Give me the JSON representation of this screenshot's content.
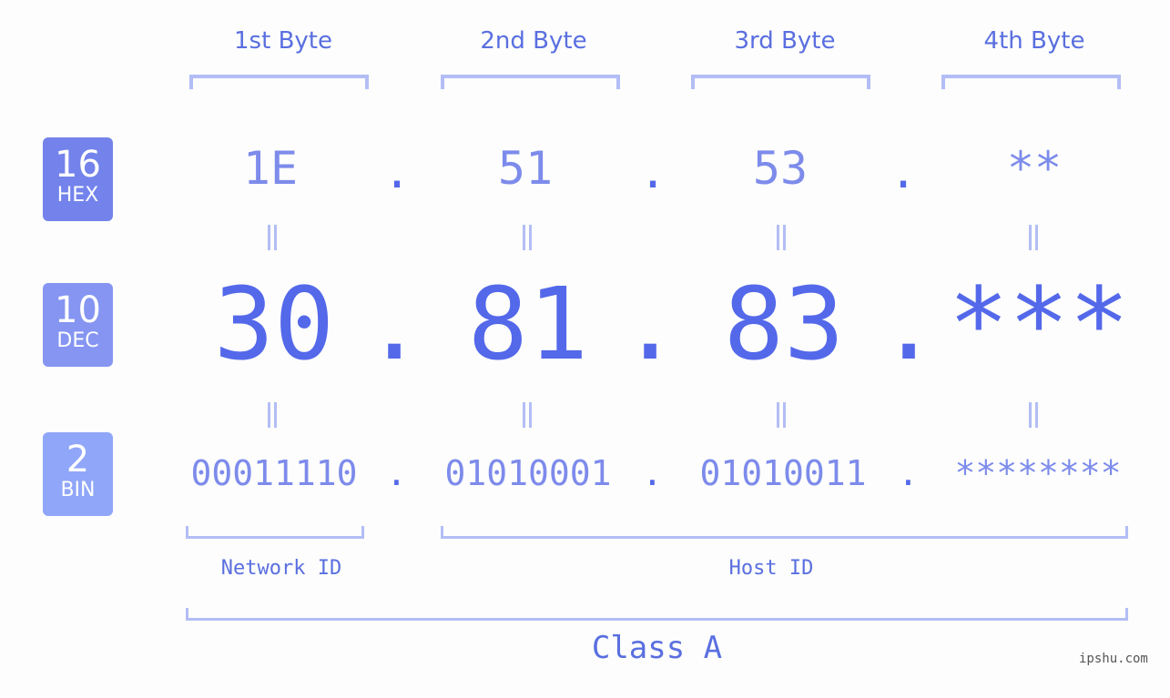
{
  "byte_headers": [
    "1st Byte",
    "2nd Byte",
    "3rd Byte",
    "4th Byte"
  ],
  "badges": [
    {
      "number": "16",
      "label": "HEX",
      "color": "#7383eb"
    },
    {
      "number": "10",
      "label": "DEC",
      "color": "#8595f1"
    },
    {
      "number": "2",
      "label": "BIN",
      "color": "#90a6f8"
    }
  ],
  "hex": [
    "1E",
    "51",
    "53",
    "**"
  ],
  "dec": [
    "30",
    "81",
    "83",
    "***"
  ],
  "bin": [
    "00011110",
    "01010001",
    "01010011",
    "********"
  ],
  "separator": ".",
  "network_id_label": "Network ID",
  "host_id_label": "Host ID",
  "class_label": "Class A",
  "watermark": "ipshu.com",
  "colors": {
    "primary": "#5468ea",
    "light": "#7d8beb",
    "bracket": "#b3bdf5",
    "background": "#fcfdfc"
  }
}
